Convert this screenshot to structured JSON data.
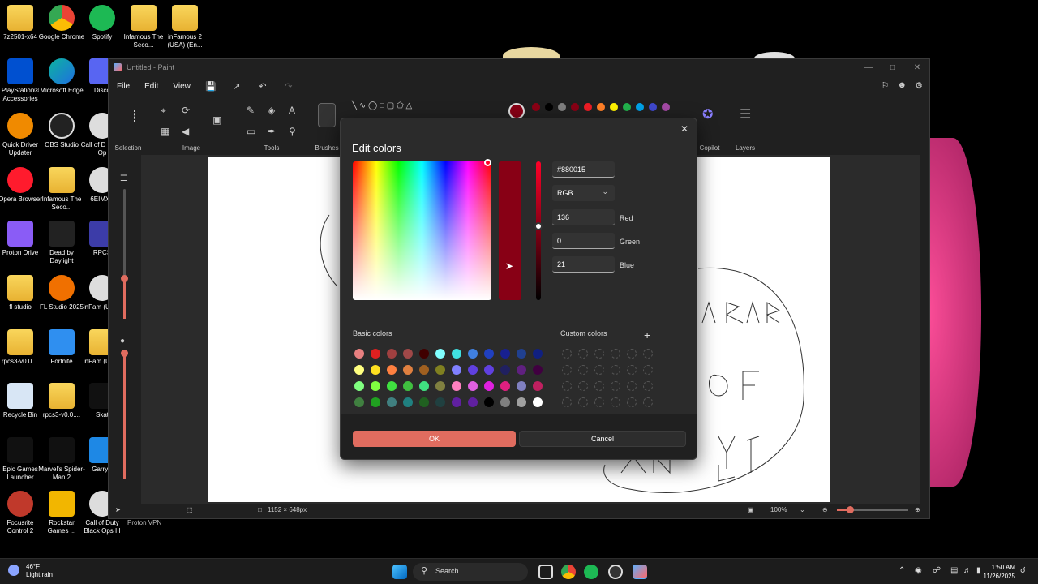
{
  "desktop": {
    "icons": [
      {
        "label": "7z2501-x64",
        "kind": "folder"
      },
      {
        "label": "Google Chrome",
        "kind": "chrome"
      },
      {
        "label": "Spotify",
        "kind": "spotify"
      },
      {
        "label": "Infamous The Seco...",
        "kind": "folder"
      },
      {
        "label": "inFamous 2 (USA) (En...",
        "kind": "folder"
      },
      {
        "label": "PlayStation® Accessories",
        "kind": "ps"
      },
      {
        "label": "Microsoft Edge",
        "kind": "edge"
      },
      {
        "label": "Disco",
        "kind": "discord"
      },
      {
        "label": "Quick Driver Updater",
        "kind": "qdu"
      },
      {
        "label": "OBS Studio",
        "kind": "obs"
      },
      {
        "label": "Call of D Black Op",
        "kind": "cod"
      },
      {
        "label": "Opera Browser",
        "kind": "opera"
      },
      {
        "label": "Infamous The Seco...",
        "kind": "folder"
      },
      {
        "label": "6EIMXE",
        "kind": "file"
      },
      {
        "label": "Proton Drive",
        "kind": "proton"
      },
      {
        "label": "Dead by Daylight",
        "kind": "dbd"
      },
      {
        "label": "RPCS",
        "kind": "rpcs"
      },
      {
        "label": "fl studio",
        "kind": "folder"
      },
      {
        "label": "FL Studio 2025",
        "kind": "fl"
      },
      {
        "label": "inFam (USA)",
        "kind": "file"
      },
      {
        "label": "rpcs3-v0.0....",
        "kind": "folder"
      },
      {
        "label": "Fortnite",
        "kind": "fortnite"
      },
      {
        "label": "inFam (USA)",
        "kind": "folder"
      },
      {
        "label": "Recycle Bin",
        "kind": "bin"
      },
      {
        "label": "rpcs3-v0.0....",
        "kind": "folder"
      },
      {
        "label": "Skat",
        "kind": "skate"
      },
      {
        "label": "Epic Games Launcher",
        "kind": "epic"
      },
      {
        "label": "Marvel's Spider-Man 2",
        "kind": "spiderman"
      },
      {
        "label": "Garry's",
        "kind": "gmod"
      },
      {
        "label": "Focusrite Control 2",
        "kind": "focusrite"
      },
      {
        "label": "Rockstar Games ...",
        "kind": "rockstar"
      },
      {
        "label": "Call of Duty Black Ops III",
        "kind": "cod"
      }
    ],
    "behind_label": "Proton VPN"
  },
  "paint": {
    "title": "Untitled - Paint",
    "menu": [
      "File",
      "Edit",
      "View"
    ],
    "groups": {
      "selection": "Selection",
      "image": "Image",
      "tools": "Tools",
      "brushes": "Brushes",
      "copilot": "Copilot",
      "layers": "Layers"
    },
    "top_palette": [
      "#8b0015",
      "#000000",
      "#7f7f7f",
      "#880015",
      "#ed1c24",
      "#ff7f27",
      "#fff200",
      "#22b14c",
      "#00a2e8",
      "#3f48cc",
      "#a349a4"
    ],
    "status": {
      "canvas_size": "1152 × 648px",
      "zoom": "100%"
    },
    "canvas_drawing_text": [
      "SKAR",
      "O",
      "KY",
      "AN",
      "P"
    ]
  },
  "dialog": {
    "title": "Edit colors",
    "hex": "#880015",
    "mode": "RGB",
    "red_value": "136",
    "red_label": "Red",
    "green_value": "0",
    "green_label": "Green",
    "blue_value": "21",
    "blue_label": "Blue",
    "current_color": "#880015",
    "value_level": 0.53,
    "basic_colors_label": "Basic colors",
    "custom_colors_label": "Custom colors",
    "basic_colors": [
      "#e88080",
      "#e02020",
      "#a04040",
      "#a04848",
      "#400000",
      "#80ffff",
      "#40e0e0",
      "#4080e0",
      "#2040c0",
      "#182090",
      "#204090",
      "#102080",
      "#ffff80",
      "#ffe020",
      "#ff8040",
      "#e08040",
      "#a06020",
      "#808020",
      "#8080ff",
      "#6040e0",
      "#6040e0",
      "#202060",
      "#602080",
      "#400040",
      "#80ff80",
      "#80ff40",
      "#40e040",
      "#40c040",
      "#40e080",
      "#808040",
      "#ff80c0",
      "#e060e0",
      "#e020e0",
      "#e02080",
      "#8080c0",
      "#c02060",
      "#408040",
      "#20a020",
      "#408080",
      "#208080",
      "#206020",
      "#204040",
      "#6020a0",
      "#6020a0",
      "#000000",
      "#808080",
      "#a0a0a0",
      "#ffffff"
    ],
    "custom_count": 24,
    "ok_label": "OK",
    "cancel_label": "Cancel"
  },
  "taskbar": {
    "weather_temp": "46°F",
    "weather_desc": "Light rain",
    "search_placeholder": "Search",
    "time": "1:50 AM",
    "date": "11/26/2025"
  }
}
